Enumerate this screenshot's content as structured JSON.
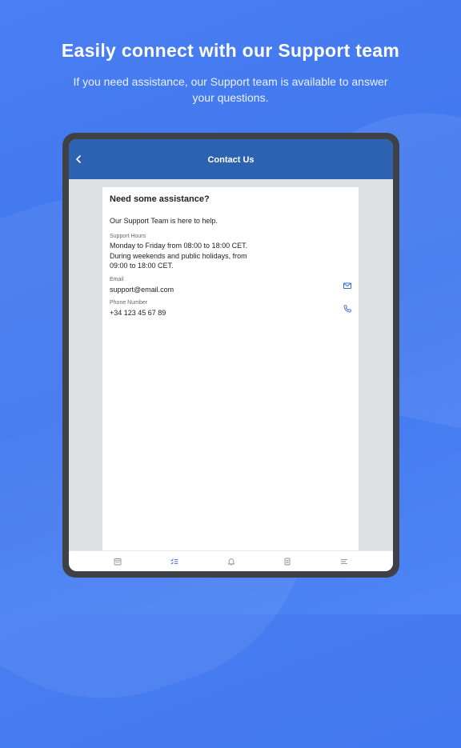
{
  "hero": {
    "title": "Easily connect with our Support team",
    "subtitle": "If you need assistance, our Support team is available to answer your questions."
  },
  "navbar": {
    "title": "Contact Us",
    "back_icon": "chevron-left-icon"
  },
  "card": {
    "heading": "Need some assistance?",
    "intro": "Our Support Team is here to help.",
    "support_hours": {
      "label": "Support Hours",
      "line1": "Monday to Friday from 08:00 to 18:00 CET.",
      "line2": "During weekends and public holidays, from",
      "line3": "09:00 to 18:00 CET."
    },
    "email": {
      "label": "Email",
      "value": "support@email.com",
      "icon": "mail-icon"
    },
    "phone": {
      "label": "Phone Number",
      "value": "+34 123 45 67 89",
      "icon": "phone-icon"
    }
  },
  "tabbar": {
    "items": [
      {
        "icon": "calendar-icon",
        "active": false
      },
      {
        "icon": "checklist-icon",
        "active": true
      },
      {
        "icon": "bell-icon",
        "active": false
      },
      {
        "icon": "document-icon",
        "active": false
      },
      {
        "icon": "menu-icon",
        "active": false
      }
    ]
  },
  "colors": {
    "background": "#4a7ef2",
    "navbar": "#2d62b0",
    "accent": "#2f6fd6",
    "tab_inactive": "#8a8f96"
  }
}
